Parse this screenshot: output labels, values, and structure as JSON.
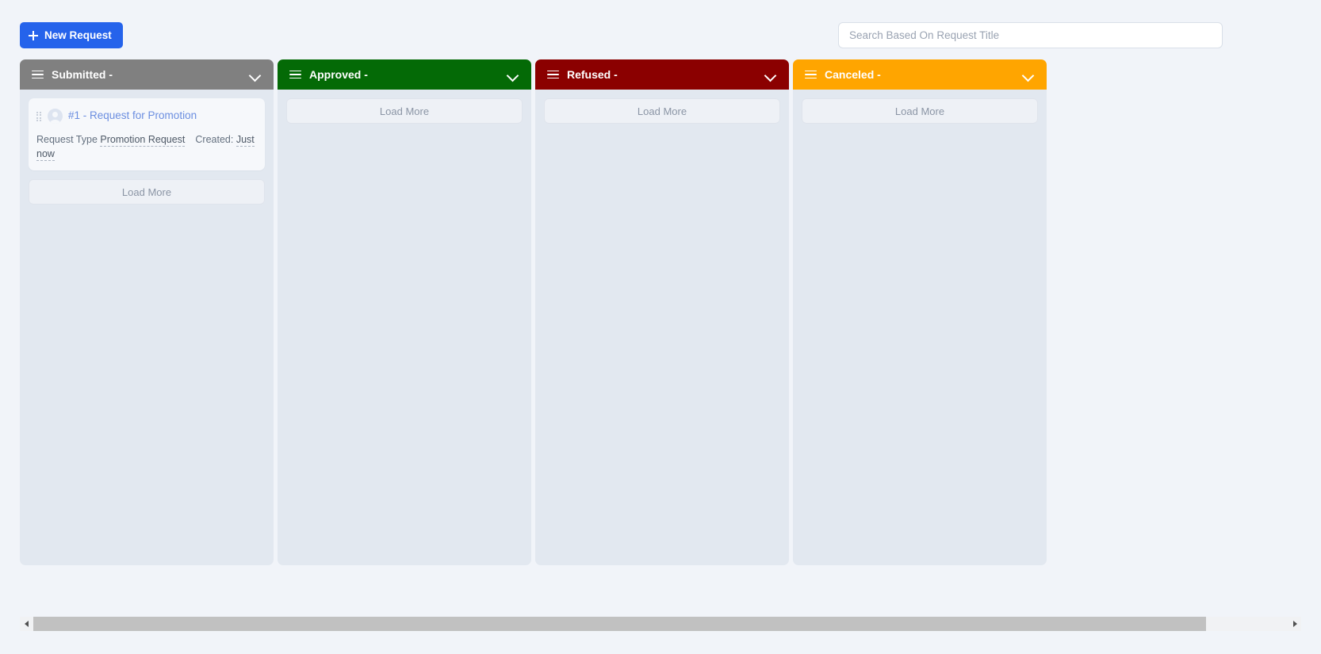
{
  "toolbar": {
    "new_request_label": "New Request",
    "search_placeholder": "Search Based On Request Title",
    "search_value": ""
  },
  "board": {
    "load_more_label": "Load More",
    "columns": [
      {
        "id": "submitted",
        "title": "Submitted -",
        "color": "#808080",
        "cards": [
          {
            "title": "#1 - Request for Promotion",
            "type_label": "Request Type",
            "type_value": "Promotion Request",
            "created_label": "Created:",
            "created_value": "Just now"
          }
        ]
      },
      {
        "id": "approved",
        "title": "Approved -",
        "color": "#046A06",
        "cards": []
      },
      {
        "id": "refused",
        "title": "Refused -",
        "color": "#8B0000",
        "cards": []
      },
      {
        "id": "canceled",
        "title": "Canceled -",
        "color": "#FFA500",
        "cards": []
      }
    ]
  },
  "scrollbar": {
    "thumb_start_percent": 0,
    "thumb_width_percent": 93.5
  }
}
